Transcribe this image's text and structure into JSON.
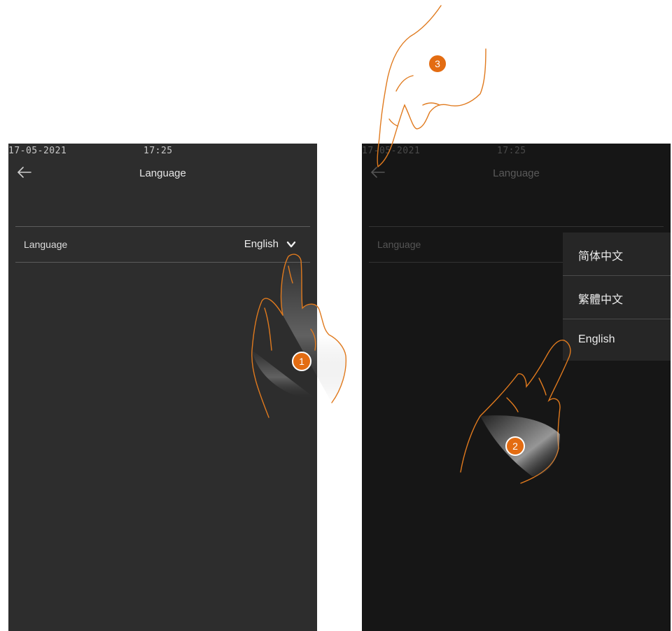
{
  "left_screen": {
    "status": {
      "date": "17-05-2021",
      "time": "17:25"
    },
    "header": {
      "title": "Language",
      "back_icon": "arrow-left-icon"
    },
    "setting": {
      "label": "Language",
      "value": "English",
      "chevron_icon": "chevron-down-icon"
    }
  },
  "right_screen": {
    "status": {
      "date": "17-05-2021",
      "time": "17:25"
    },
    "header": {
      "title": "Language",
      "back_icon": "arrow-left-icon"
    },
    "setting": {
      "label": "Language"
    },
    "dropdown": {
      "options": [
        "简体中文",
        "繁體中文",
        "English"
      ]
    }
  },
  "steps": [
    "1",
    "2",
    "3"
  ],
  "colors": {
    "badge": "#e36c12",
    "hand_outline": "#e07a1e",
    "screen_bg": "#2d2d2d",
    "screen_dimmed_bg": "#161616"
  }
}
